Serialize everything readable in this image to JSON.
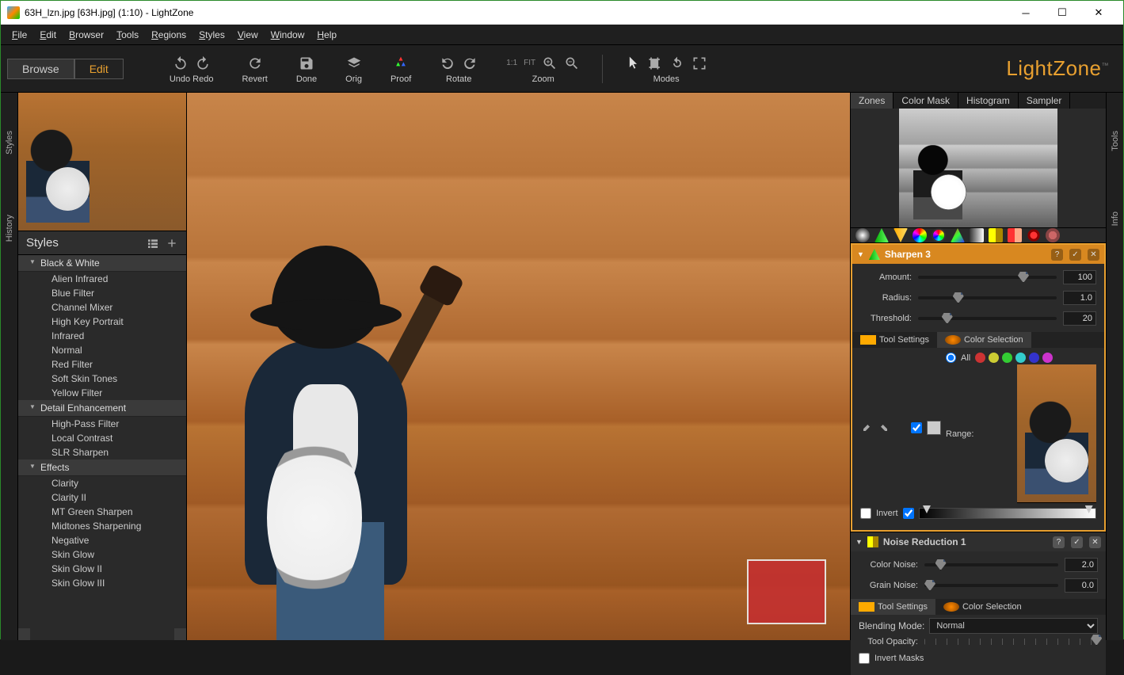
{
  "window": {
    "title": "63H_lzn.jpg [63H.jpg] (1:10) - LightZone"
  },
  "menu": {
    "file": "File",
    "edit": "Edit",
    "browser": "Browser",
    "tools": "Tools",
    "regions": "Regions",
    "styles": "Styles",
    "view": "View",
    "window": "Window",
    "help": "Help"
  },
  "mode": {
    "browse": "Browse",
    "edit": "Edit"
  },
  "toolbar": {
    "undoRedo": "Undo Redo",
    "revert": "Revert",
    "done": "Done",
    "orig": "Orig",
    "proof": "Proof",
    "rotate": "Rotate",
    "zoom": "Zoom",
    "modes": "Modes",
    "oneToOne": "1:1",
    "fit": "FIT"
  },
  "logo": "LightZone",
  "sideTabs": {
    "styles": "Styles",
    "history": "History",
    "tools": "Tools",
    "info": "Info"
  },
  "stylesPanel": {
    "title": "Styles",
    "groups": [
      {
        "name": "Black & White",
        "items": [
          "Alien Infrared",
          "Blue Filter",
          "Channel Mixer",
          "High Key Portrait",
          "Infrared",
          "Normal",
          "Red Filter",
          "Soft Skin Tones",
          "Yellow Filter"
        ]
      },
      {
        "name": "Detail Enhancement",
        "items": [
          "High-Pass Filter",
          "Local Contrast",
          "SLR Sharpen"
        ]
      },
      {
        "name": "Effects",
        "items": [
          "Clarity",
          "Clarity II",
          "MT Green Sharpen",
          "Midtones Sharpening",
          "Negative",
          "Skin Glow",
          "Skin Glow II",
          "Skin Glow III"
        ]
      }
    ]
  },
  "rightTabs": {
    "zones": "Zones",
    "colorMask": "Color Mask",
    "histogram": "Histogram",
    "sampler": "Sampler"
  },
  "sharpen": {
    "title": "Sharpen 3",
    "amount": {
      "label": "Amount:",
      "value": "100",
      "pos": 72
    },
    "radius": {
      "label": "Radius:",
      "value": "1.0",
      "pos": 25
    },
    "threshold": {
      "label": "Threshold:",
      "value": "20",
      "pos": 17
    },
    "toolSettings": "Tool Settings",
    "colorSelection": "Color Selection",
    "all": "All",
    "range": "Range:",
    "invert": "Invert"
  },
  "noise": {
    "title": "Noise Reduction 1",
    "colorNoise": {
      "label": "Color Noise:",
      "value": "2.0",
      "pos": 8
    },
    "grainNoise": {
      "label": "Grain Noise:",
      "value": "0.0",
      "pos": 0
    },
    "toolSettings": "Tool Settings",
    "colorSelection": "Color Selection",
    "blendingMode": "Blending Mode:",
    "blendValue": "Normal",
    "toolOpacity": "Tool Opacity:",
    "invertMasks": "Invert Masks"
  }
}
